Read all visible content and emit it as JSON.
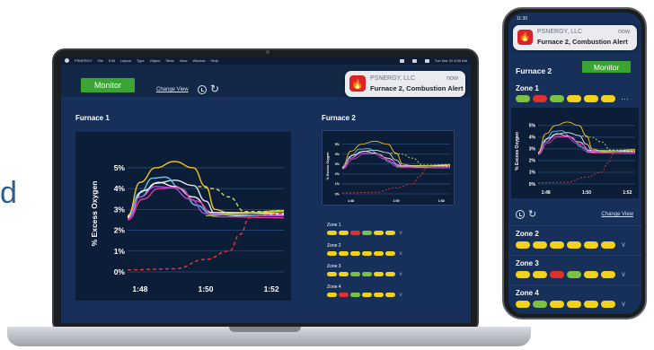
{
  "edge_glyph": "d",
  "colors": {
    "screen_bg": "#16305a",
    "chart_bg": "#0c1d38",
    "accent_green": "#3aa534",
    "alert_red": "#d8232a",
    "pill_green": "#7cc142",
    "pill_yellow": "#f2d21b",
    "pill_red": "#e03030"
  },
  "laptop": {
    "menubar": {
      "app": "PSNERGY",
      "menus": [
        "File",
        "Edit",
        "Layout",
        "Type",
        "Object",
        "Table",
        "View",
        "Window",
        "Help"
      ],
      "clock": "Tue Mar 22  8:30 AM"
    },
    "monitor_label": "Monitor",
    "change_view_label": "Change View",
    "refresh_glyph": "↻",
    "notification": {
      "company": "PSNERGY, LLC",
      "time": "now",
      "message": "Furnace 2, Combustion Alert",
      "icon": "flame-icon",
      "glyph": "🔥"
    },
    "furnace1_title": "Furnace 1",
    "furnace2_title": "Furnace 2",
    "zones": [
      {
        "label": "Zone 1",
        "pills": [
          "yellow",
          "yellow",
          "red",
          "green",
          "yellow",
          "yellow"
        ]
      },
      {
        "label": "Zone 2",
        "pills": [
          "yellow",
          "yellow",
          "yellow",
          "yellow",
          "yellow",
          "yellow"
        ]
      },
      {
        "label": "Zone 3",
        "pills": [
          "yellow",
          "yellow",
          "green",
          "green",
          "yellow",
          "yellow"
        ]
      },
      {
        "label": "Zone 4",
        "pills": [
          "yellow",
          "red",
          "green",
          "yellow",
          "yellow",
          "yellow"
        ]
      }
    ],
    "chevron_glyph": "∨"
  },
  "phone": {
    "status_time": "11:30",
    "notification": {
      "company": "PSNERGY, LLC",
      "time": "now",
      "message": "Furnace 2, Combustion Alert",
      "icon": "flame-icon",
      "glyph": "🔥"
    },
    "title": "Furnace 2",
    "monitor_label": "Monitor",
    "zone1": {
      "label": "Zone 1",
      "pills": [
        "green",
        "red",
        "green",
        "yellow",
        "yellow",
        "yellow"
      ]
    },
    "more_glyph": "···",
    "change_view_label": "Change View",
    "refresh_glyph": "↻",
    "zones": [
      {
        "label": "Zone 2",
        "pills": [
          "yellow",
          "yellow",
          "yellow",
          "yellow",
          "yellow",
          "yellow"
        ]
      },
      {
        "label": "Zone 3",
        "pills": [
          "yellow",
          "yellow",
          "red",
          "green",
          "yellow",
          "yellow"
        ]
      },
      {
        "label": "Zone 4",
        "pills": [
          "yellow",
          "green",
          "yellow",
          "yellow",
          "yellow",
          "yellow"
        ]
      }
    ],
    "chevron_glyph": "∨"
  },
  "chart_data": [
    {
      "type": "line",
      "ylabel": "% Excess Oxygen",
      "yticks": [
        "0%",
        "1%",
        "2%",
        "3%",
        "4%",
        "5%"
      ],
      "xticks": [
        "1:48",
        "1:50",
        "1:52"
      ],
      "ylim": [
        0,
        5.6
      ],
      "xlim": [
        0,
        1
      ],
      "grid": true,
      "series": [
        {
          "color": "#f5c518",
          "style": "solid",
          "points": [
            [
              0,
              2.7
            ],
            [
              0.08,
              4.3
            ],
            [
              0.18,
              5.0
            ],
            [
              0.3,
              5.3
            ],
            [
              0.42,
              5.0
            ],
            [
              0.5,
              4.1
            ],
            [
              0.56,
              3.0
            ],
            [
              0.64,
              2.85
            ],
            [
              0.8,
              2.85
            ],
            [
              1,
              2.9
            ]
          ]
        },
        {
          "color": "#e2e8f0",
          "style": "solid",
          "points": [
            [
              0,
              2.65
            ],
            [
              0.08,
              3.6
            ],
            [
              0.18,
              4.25
            ],
            [
              0.3,
              4.4
            ],
            [
              0.42,
              4.15
            ],
            [
              0.5,
              3.4
            ],
            [
              0.56,
              2.8
            ],
            [
              0.7,
              2.7
            ],
            [
              1,
              2.75
            ]
          ]
        },
        {
          "color": "#5ec8f0",
          "style": "solid",
          "points": [
            [
              0,
              2.6
            ],
            [
              0.08,
              3.8
            ],
            [
              0.16,
              4.5
            ],
            [
              0.24,
              4.55
            ],
            [
              0.34,
              4.0
            ],
            [
              0.44,
              3.2
            ],
            [
              0.54,
              2.75
            ],
            [
              1,
              2.7
            ]
          ]
        },
        {
          "color": "#f3f3f3",
          "style": "solid",
          "points": [
            [
              0,
              2.6
            ],
            [
              0.1,
              3.9
            ],
            [
              0.2,
              4.3
            ],
            [
              0.3,
              4.1
            ],
            [
              0.42,
              3.6
            ],
            [
              0.54,
              2.85
            ],
            [
              1,
              2.8
            ]
          ]
        },
        {
          "color": "#a84de0",
          "style": "solid",
          "points": [
            [
              0,
              2.55
            ],
            [
              0.08,
              3.6
            ],
            [
              0.18,
              4.1
            ],
            [
              0.28,
              4.05
            ],
            [
              0.4,
              3.5
            ],
            [
              0.5,
              2.8
            ],
            [
              1,
              2.7
            ]
          ]
        },
        {
          "color": "#e0399a",
          "style": "solid",
          "points": [
            [
              0,
              2.5
            ],
            [
              0.1,
              3.5
            ],
            [
              0.2,
              4.0
            ],
            [
              0.32,
              4.05
            ],
            [
              0.44,
              3.4
            ],
            [
              0.56,
              2.65
            ],
            [
              1,
              2.6
            ]
          ]
        },
        {
          "color": "#9ac43a",
          "style": "solid",
          "points": [
            [
              0.5,
              2.7
            ],
            [
              0.7,
              2.8
            ],
            [
              1,
              2.95
            ]
          ]
        },
        {
          "color": "#e83a3a",
          "style": "dashed",
          "points": [
            [
              0,
              0.1
            ],
            [
              0.3,
              0.15
            ],
            [
              0.5,
              0.6
            ],
            [
              0.65,
              1.0
            ],
            [
              0.72,
              1.8
            ],
            [
              0.78,
              2.6
            ],
            [
              0.9,
              2.75
            ],
            [
              1,
              2.8
            ]
          ]
        },
        {
          "color": "#cbe04a",
          "style": "dashed",
          "points": [
            [
              0.45,
              4.1
            ],
            [
              0.55,
              4.0
            ],
            [
              0.65,
              3.6
            ],
            [
              0.75,
              2.9
            ],
            [
              0.85,
              2.9
            ],
            [
              1,
              2.95
            ]
          ]
        }
      ]
    },
    {
      "type": "line",
      "ylabel": "% Excess Oxygen",
      "yticks": [
        "0%",
        "1%",
        "2%",
        "3%",
        "4%",
        "5%"
      ],
      "xticks": [
        "1:48",
        "1:50",
        "1:52"
      ],
      "ylim": [
        0,
        5.6
      ],
      "xlim": [
        0,
        1
      ],
      "grid": true
    },
    {
      "type": "line",
      "ylabel": "% Excess Oxygen",
      "yticks": [
        "0%",
        "1%",
        "2%",
        "3%",
        "4%",
        "5%"
      ],
      "xticks": [
        "1:48",
        "1:50",
        "1:52"
      ],
      "ylim": [
        0,
        5.6
      ],
      "xlim": [
        0,
        1
      ],
      "grid": true
    }
  ]
}
